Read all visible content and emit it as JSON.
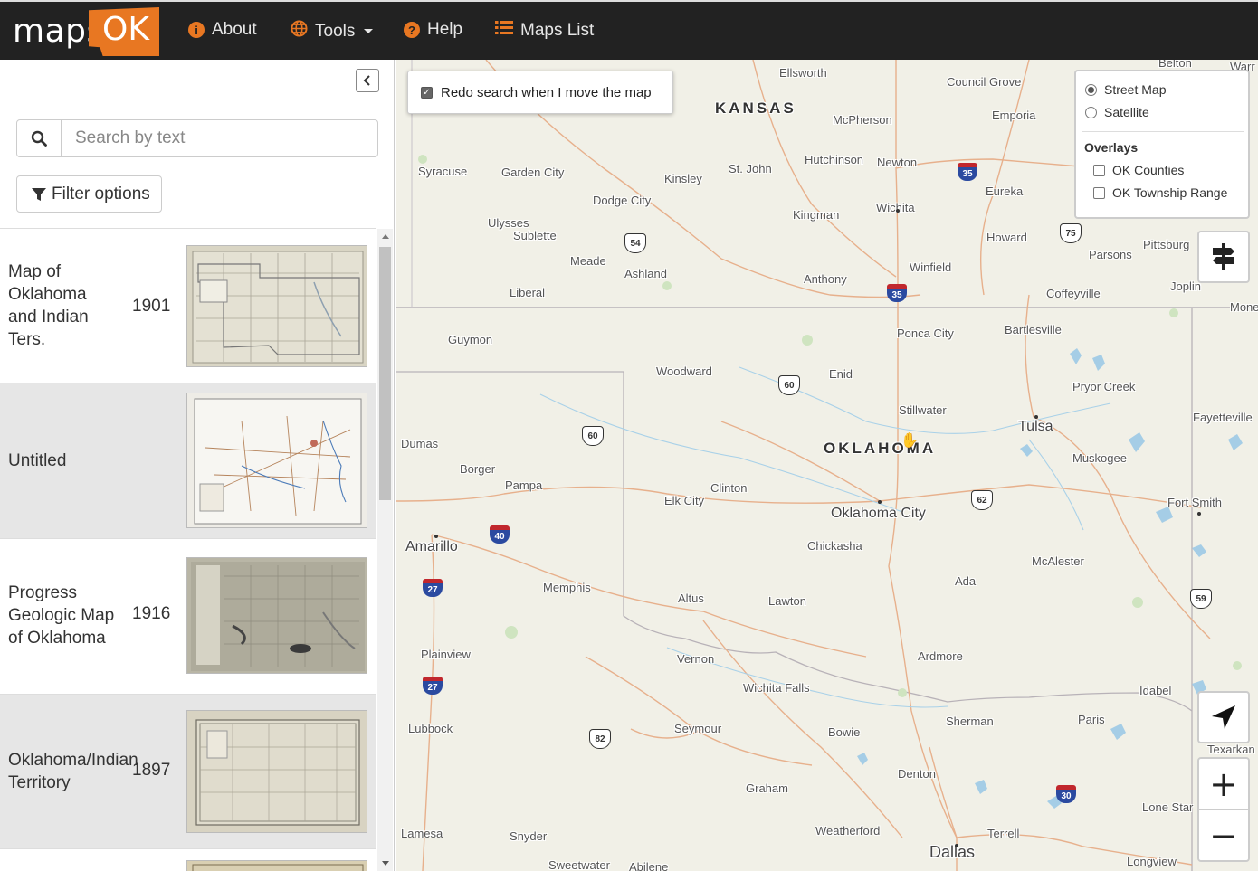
{
  "brand": {
    "logo_left": "maps",
    "logo_right": "OK",
    "accent": "#e87722"
  },
  "nav": {
    "about": "About",
    "tools": "Tools",
    "help": "Help",
    "maps_list": "Maps List"
  },
  "sidebar": {
    "search_placeholder": "Search by text",
    "filter_label": "Filter options",
    "results": [
      {
        "title": "Map of Oklahoma and Indian Ters.",
        "year": "1901"
      },
      {
        "title": "Untitled",
        "year": ""
      },
      {
        "title": "Progress Geologic Map of Oklahoma",
        "year": "1916"
      },
      {
        "title": "Oklahoma/Indian Territory",
        "year": "1897"
      }
    ]
  },
  "map": {
    "redo_search_label": "Redo search when I move the map",
    "redo_search_checked": true,
    "base_layers": [
      {
        "label": "Street Map",
        "selected": true
      },
      {
        "label": "Satellite",
        "selected": false
      }
    ],
    "overlays_title": "Overlays",
    "overlays": [
      {
        "label": "OK Counties",
        "checked": false
      },
      {
        "label": "OK Township Range",
        "checked": false
      }
    ],
    "zoom_in": "+",
    "zoom_out": "−",
    "places": {
      "kansas": "KANSAS",
      "oklahoma": "OKLAHOMA",
      "ellsworth": "Ellsworth",
      "council_grove": "Council Grove",
      "mcpherson": "McPherson",
      "emporia": "Emporia",
      "hutchinson": "Hutchinson",
      "newton": "Newton",
      "syracuse": "Syracuse",
      "garden_city": "Garden City",
      "kinsley": "Kinsley",
      "st_john": "St. John",
      "dodge_city": "Dodge City",
      "eureka": "Eureka",
      "wichita": "Wichita",
      "kingman": "Kingman",
      "ulysses": "Ulysses",
      "sublette": "Sublette",
      "howard": "Howard",
      "pittsburg": "Pittsburg",
      "parsons": "Parsons",
      "meade": "Meade",
      "ashland": "Ashland",
      "anthony": "Anthony",
      "winfield": "Winfield",
      "liberal": "Liberal",
      "coffeyville": "Coffeyville",
      "joplin": "Joplin",
      "guymon": "Guymon",
      "ponca_city": "Ponca City",
      "bartlesville": "Bartlesville",
      "woodward": "Woodward",
      "enid": "Enid",
      "pryor_creek": "Pryor Creek",
      "stillwater": "Stillwater",
      "tulsa": "Tulsa",
      "fayetteville": "Fayetteville",
      "dumas": "Dumas",
      "borger": "Borger",
      "pampa": "Pampa",
      "muskogee": "Muskogee",
      "elk_city": "Elk City",
      "clinton": "Clinton",
      "oklahoma_city": "Oklahoma City",
      "fort_smith": "Fort Smith",
      "amarillo": "Amarillo",
      "chickasha": "Chickasha",
      "mcalester": "McAlester",
      "memphis": "Memphis",
      "ada": "Ada",
      "altus": "Altus",
      "lawton": "Lawton",
      "plainview": "Plainview",
      "vernon": "Vernon",
      "ardmore": "Ardmore",
      "wichita_falls": "Wichita Falls",
      "idabel": "Idabel",
      "lubbock": "Lubbock",
      "seymour": "Seymour",
      "bowie": "Bowie",
      "sherman": "Sherman",
      "paris": "Paris",
      "texarkana": "Texarkan",
      "denton": "Denton",
      "graham": "Graham",
      "lone_star": "Lone Star",
      "lamesa": "Lamesa",
      "snyder": "Snyder",
      "weatherford": "Weatherford",
      "terrell": "Terrell",
      "dallas": "Dallas",
      "longview": "Longview",
      "sweetwater": "Sweetwater",
      "abilene": "Abilene",
      "monett": "Mone",
      "warr": "Warr",
      "belton": "Belton"
    },
    "highways": {
      "i35_ks": "35",
      "i35_ok": "35",
      "us54": "54",
      "us60_enid": "60",
      "us60_tx": "60",
      "us75": "75",
      "us62": "62",
      "i40": "40",
      "i27_a": "27",
      "i27_b": "27",
      "us82": "82",
      "us59": "59",
      "i30": "30"
    }
  }
}
